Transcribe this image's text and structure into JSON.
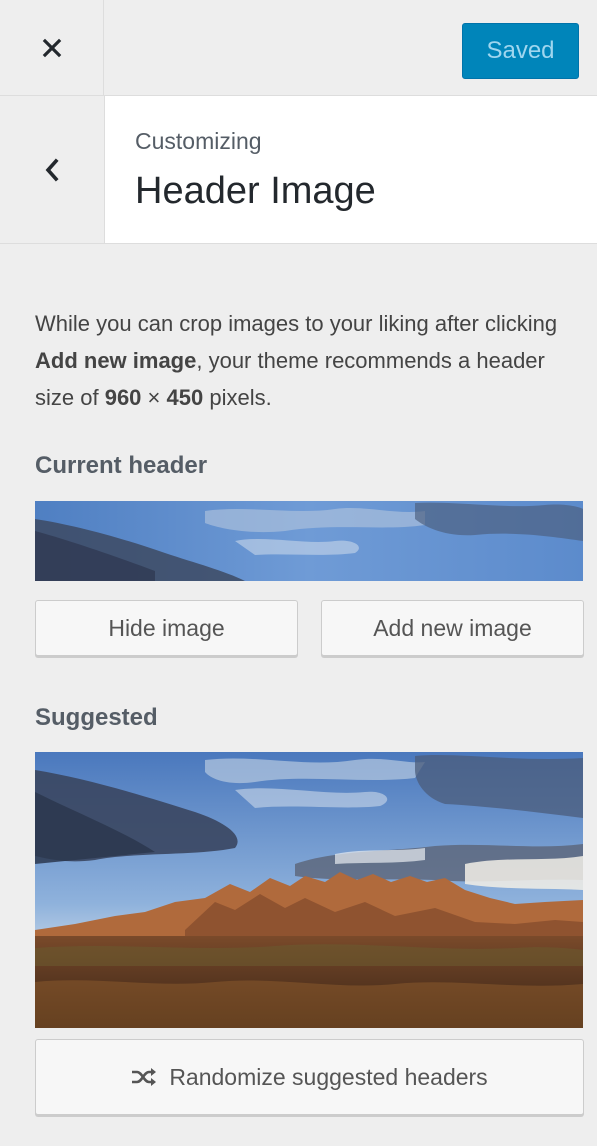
{
  "topbar": {
    "close_icon": "close-icon",
    "save_label": "Saved",
    "save_color": "#0085ba"
  },
  "section": {
    "back_icon": "chevron-left-icon",
    "crumb": "Customizing",
    "title": "Header Image"
  },
  "content": {
    "description_part1": "While you can crop images to your liking after clicking ",
    "description_bold1": "Add new image",
    "description_part2": ", your theme recommends a header size of ",
    "description_bold2": "960",
    "description_part3": " × ",
    "description_bold3": "450",
    "description_part4": " pixels.",
    "current_header_heading": "Current header",
    "hide_button": "Hide image",
    "add_button": "Add new image",
    "suggested_heading": "Suggested",
    "randomize_button": "Randomize suggested headers",
    "randomize_icon": "shuffle-icon"
  }
}
